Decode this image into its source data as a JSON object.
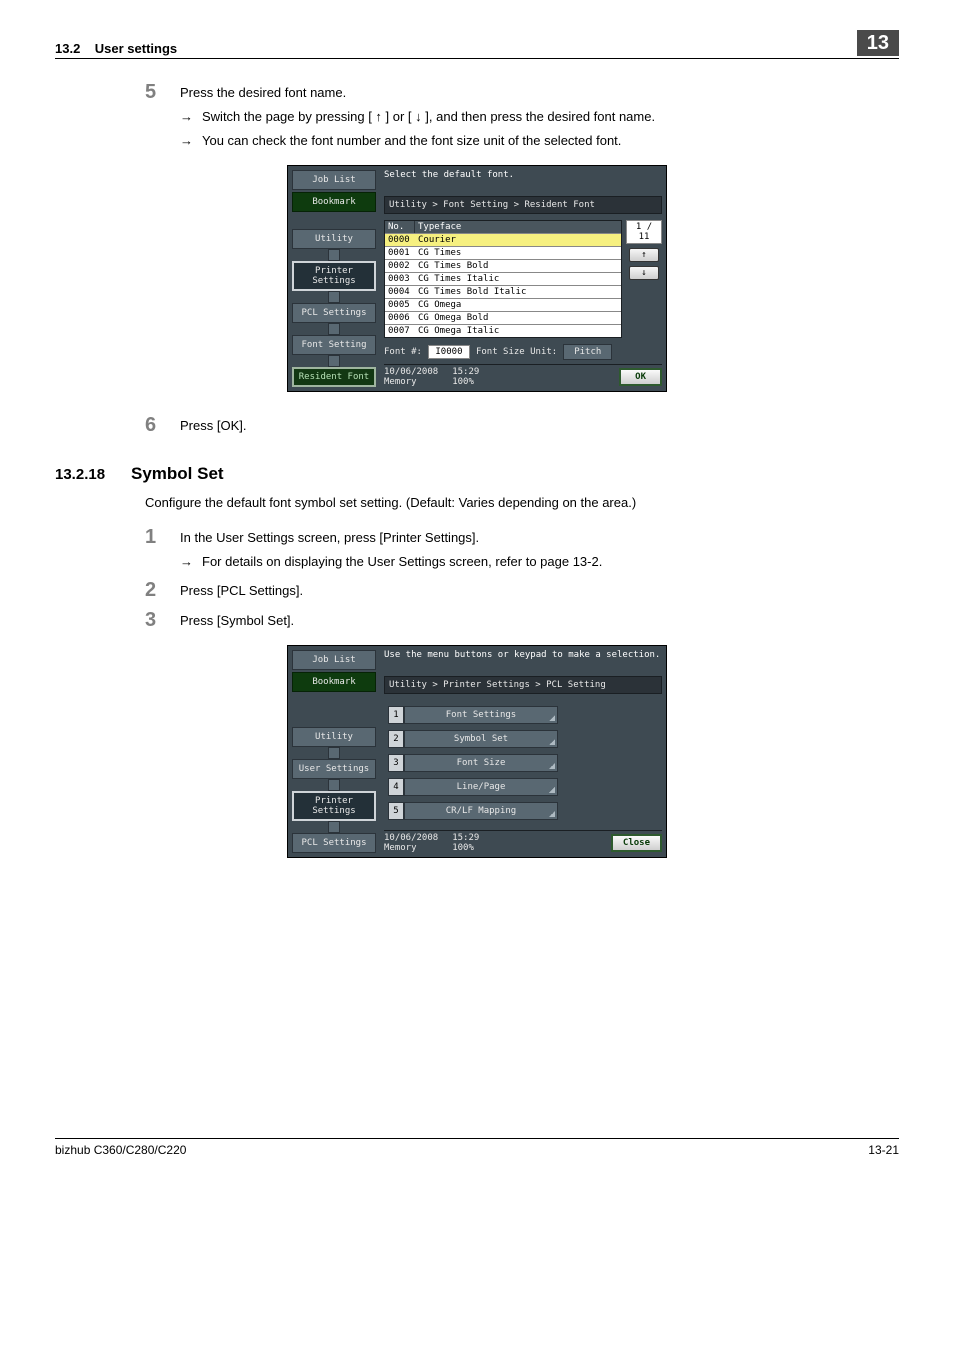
{
  "header": {
    "section_num": "13.2",
    "section_title": "User settings",
    "chapter": "13"
  },
  "step5": {
    "num": "5",
    "text": "Press the desired font name.",
    "sub1": "Switch the page by pressing [ ↑ ] or [ ↓ ], and then press the desired font name.",
    "sub2": "You can check the font number and the font size unit of the selected font."
  },
  "panel1": {
    "sidebar": {
      "joblist": "Job List",
      "bookmark": "Bookmark",
      "utility": "Utility",
      "printer_settings": "Printer Settings",
      "pcl_settings": "PCL Settings",
      "font_setting": "Font Setting",
      "resident_font": "Resident Font"
    },
    "instruction": "Select the default font.",
    "breadcrumb": "Utility > Font Setting > Resident Font",
    "table_head_no": "No.",
    "table_head_tf": "Typeface",
    "page_indicator": "1 / 11",
    "fonts": [
      {
        "no": "0000",
        "name": "Courier"
      },
      {
        "no": "0001",
        "name": "CG Times"
      },
      {
        "no": "0002",
        "name": "CG Times Bold"
      },
      {
        "no": "0003",
        "name": "CG Times Italic"
      },
      {
        "no": "0004",
        "name": "CG Times Bold Italic"
      },
      {
        "no": "0005",
        "name": "CG Omega"
      },
      {
        "no": "0006",
        "name": "CG Omega Bold"
      },
      {
        "no": "0007",
        "name": "CG Omega Italic"
      }
    ],
    "font_num_label": "Font #:",
    "font_num_value": "I0000",
    "font_size_unit_label": "Font Size Unit:",
    "font_size_unit_value": "Pitch",
    "date": "10/06/2008",
    "time": "15:29",
    "memory_label": "Memory",
    "memory_value": "100%",
    "ok": "OK"
  },
  "step6": {
    "num": "6",
    "text": "Press [OK]."
  },
  "subsection": {
    "num": "13.2.18",
    "title": "Symbol Set"
  },
  "intro": "Configure the default font symbol set setting. (Default: Varies depending on the area.)",
  "step1": {
    "num": "1",
    "text": "In the User Settings screen, press [Printer Settings].",
    "sub1": "For details on displaying the User Settings screen, refer to page 13-2."
  },
  "step2": {
    "num": "2",
    "text": "Press [PCL Settings]."
  },
  "step3": {
    "num": "3",
    "text": "Press [Symbol Set]."
  },
  "panel2": {
    "sidebar": {
      "joblist": "Job List",
      "bookmark": "Bookmark",
      "utility": "Utility",
      "user_settings": "User Settings",
      "printer_settings": "Printer Settings",
      "pcl_settings": "PCL Settings"
    },
    "instruction": "Use the menu buttons or keypad to make a selection.",
    "breadcrumb": "Utility > Printer Settings > PCL Setting",
    "menu": [
      {
        "n": "1",
        "label": "Font Settings"
      },
      {
        "n": "2",
        "label": "Symbol Set"
      },
      {
        "n": "3",
        "label": "Font Size"
      },
      {
        "n": "4",
        "label": "Line/Page"
      },
      {
        "n": "5",
        "label": "CR/LF Mapping"
      }
    ],
    "date": "10/06/2008",
    "time": "15:29",
    "memory_label": "Memory",
    "memory_value": "100%",
    "close": "Close"
  },
  "footer": {
    "product": "bizhub C360/C280/C220",
    "page": "13-21"
  }
}
